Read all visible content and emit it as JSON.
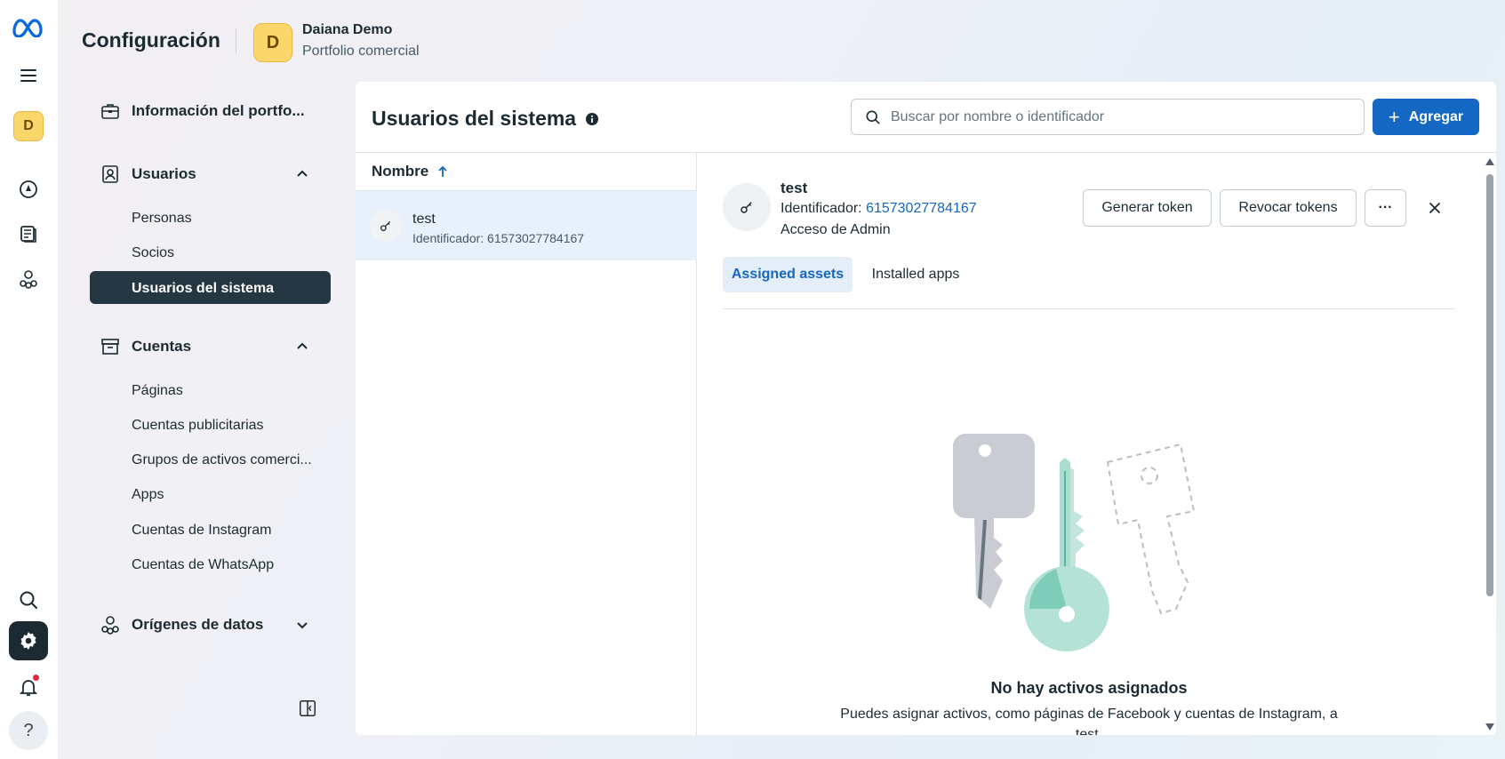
{
  "header": {
    "title": "Configuración",
    "avatar_letter": "D",
    "account_name": "Daiana Demo",
    "account_type": "Portfolio comercial"
  },
  "rail": {
    "avatar_letter": "D",
    "help_symbol": "?"
  },
  "sidebar": {
    "portfolio_info": "Información del portfo...",
    "users_section": "Usuarios",
    "users_items": [
      "Personas",
      "Socios"
    ],
    "active_item": "Usuarios del sistema",
    "accounts_section": "Cuentas",
    "accounts_items": [
      "Páginas",
      "Cuentas publicitarias",
      "Grupos de activos comerci...",
      "Apps",
      "Cuentas de Instagram",
      "Cuentas de WhatsApp"
    ],
    "data_sources_section": "Orígenes de datos"
  },
  "main": {
    "title": "Usuarios del sistema",
    "search_placeholder": "Buscar por nombre o identificador",
    "add_label": "Agregar",
    "column_name": "Nombre",
    "rows": [
      {
        "name": "test",
        "id": "Identificador: 61573027784167"
      }
    ]
  },
  "detail": {
    "name": "test",
    "id_label": "Identificador: ",
    "id_value": "61573027784167",
    "access": "Acceso de Admin",
    "generate_token": "Generar token",
    "revoke_tokens": "Revocar tokens",
    "more": "···",
    "tabs": [
      "Assigned assets",
      "Installed apps"
    ],
    "empty_title": "No hay activos asignados",
    "empty_desc": "Puedes asignar activos, como páginas de Facebook y cuentas de Instagram, a test."
  },
  "colors": {
    "accent": "#1467c2",
    "active_nav": "#253743",
    "avatar": "#fbd66b"
  }
}
